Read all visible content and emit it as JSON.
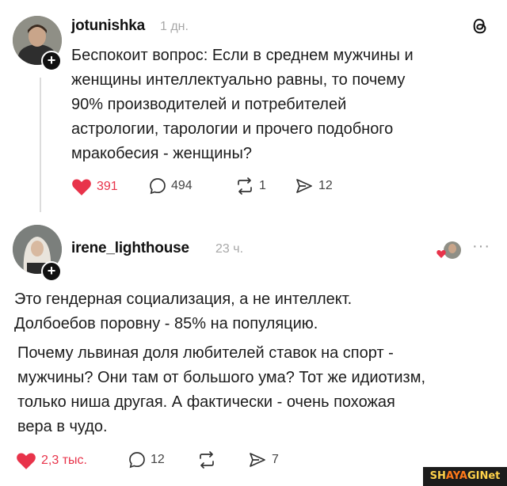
{
  "post": {
    "username": "jotunishka",
    "time": "1 дн.",
    "lines": [
      "Беспокоит вопрос: Если в среднем мужчины и",
      "женщины интеллектуально равны, то почему",
      "90% производителей и потребителей",
      "астрологии, тарологии и прочего подобного",
      "мракобесия - женщины?"
    ],
    "likes": "391",
    "comments": "494",
    "reposts": "1",
    "shares": "12"
  },
  "reply": {
    "username": "irene_lighthouse",
    "time": "23 ч.",
    "more": "···",
    "lines": [
      "Это гендерная социализация, а не интеллект.",
      "Долбоебов поровну - 85% на популяцию."
    ],
    "lines2": [
      "Почему львиная доля любителей ставок на спорт -",
      "мужчины? Они там от большого ума? Тот же идиотизм,",
      "только ниша другая. А фактически - очень похожая",
      "вера в чудо."
    ],
    "likes": "2,3 тыс.",
    "comments": "12",
    "shares": "7"
  },
  "icons": {
    "threads": "threads-logo-icon",
    "heart": "heart-icon",
    "comment": "comment-icon",
    "repost": "repost-icon",
    "share": "share-icon",
    "plus": "plus-icon"
  },
  "colors": {
    "like": "#e8334a",
    "text": "#1c1c1c",
    "muted": "#a8a8a8"
  },
  "watermark": {
    "left": "SH",
    "mid": "AYA",
    "right": "GINet"
  }
}
